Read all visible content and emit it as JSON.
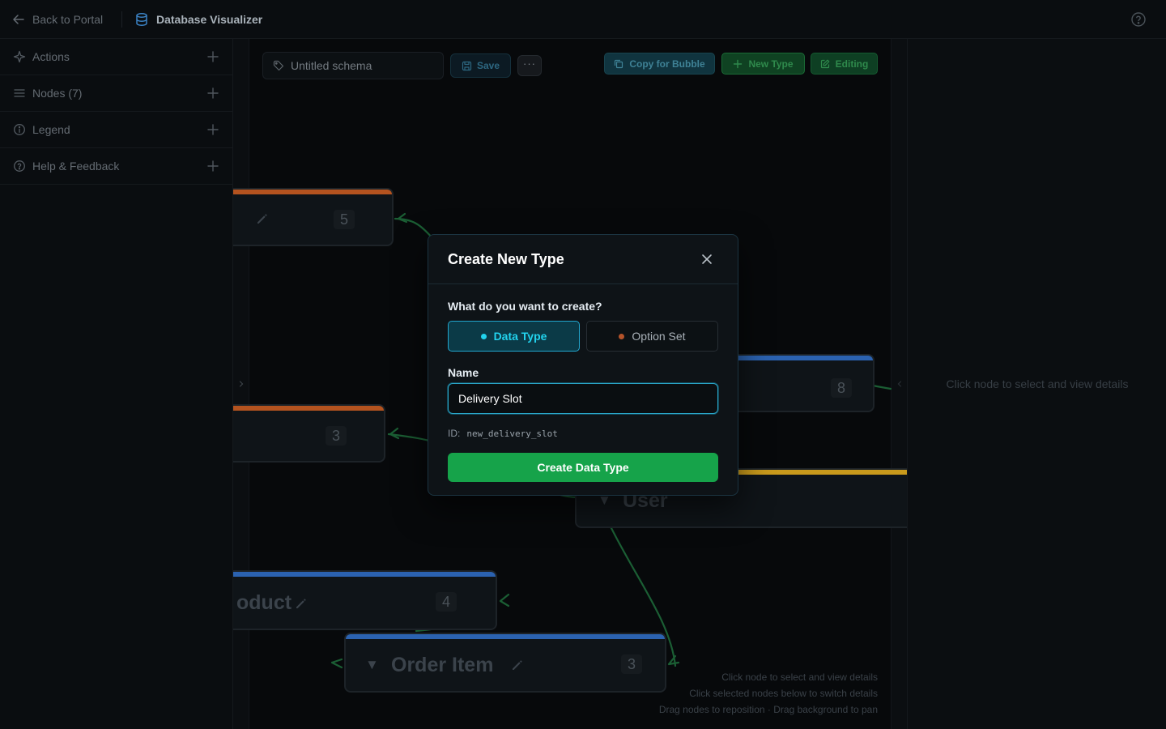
{
  "topbar": {
    "back_label": "Back to Portal",
    "app_title": "Database Visualizer",
    "help_icon": "help-circle-icon"
  },
  "sidebar": {
    "items": [
      {
        "label": "Actions",
        "icon": "sparkle-icon"
      },
      {
        "label": "Nodes (7)",
        "icon": "list-icon"
      },
      {
        "label": "Legend",
        "icon": "info-icon"
      },
      {
        "label": "Help & Feedback",
        "icon": "help-circle-icon"
      }
    ]
  },
  "toolbar": {
    "schema_name": "Untitled schema",
    "save_label": "Save",
    "more_label": "···",
    "copy_label": "Copy for Bubble",
    "new_type_label": "New Type",
    "editing_label": "Editing"
  },
  "nodes": [
    {
      "id": "node-a",
      "title": "",
      "count": "5",
      "bar_color": "#b4531f"
    },
    {
      "id": "node-b",
      "title": "",
      "count": "3",
      "bar_color": "#b4531f"
    },
    {
      "id": "node-c",
      "title": "",
      "count": "8",
      "bar_color": "#2b62b0"
    },
    {
      "id": "node-user",
      "title": "User",
      "count": "",
      "bar_color": "#c99a1c"
    },
    {
      "id": "node-product",
      "title": "oduct",
      "count": "4",
      "bar_color": "#2b62b0"
    },
    {
      "id": "node-order-item",
      "title": "Order Item",
      "count": "3",
      "bar_color": "#2b62b0"
    }
  ],
  "colors": {
    "edge": "#1b5e34",
    "accent_cyan": "#22d3ee",
    "accent_green": "#16a34a",
    "option_set_dot": "#b4532a"
  },
  "canvas_hints": {
    "line1": "Click node to select and view details",
    "line2": "Click selected nodes below to switch details",
    "line3": "Drag nodes to reposition · Drag background to pan"
  },
  "right_panel": {
    "hint": "Click node to select and view details"
  },
  "modal": {
    "title": "Create New Type",
    "question": "What do you want to create?",
    "options": [
      {
        "label": "Data Type",
        "selected": true
      },
      {
        "label": "Option Set",
        "selected": false
      }
    ],
    "name_label": "Name",
    "name_value": "Delivery Slot",
    "id_label": "ID:",
    "id_value": "new_delivery_slot",
    "create_label": "Create Data Type"
  }
}
